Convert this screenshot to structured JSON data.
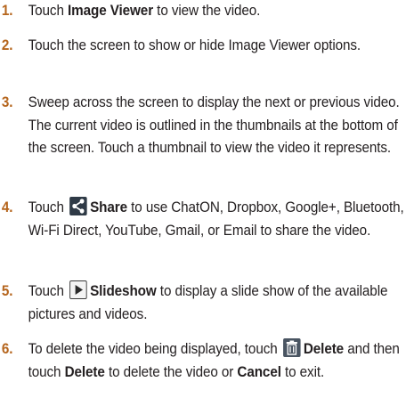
{
  "steps": [
    {
      "num": "1.",
      "parts": [
        {
          "t": "text",
          "v": "Touch "
        },
        {
          "t": "bold",
          "v": "Image Viewer"
        },
        {
          "t": "text",
          "v": " to view the video."
        }
      ]
    },
    {
      "num": "2.",
      "parts": [
        {
          "t": "text",
          "v": "Touch the screen to show or hide Image Viewer options."
        }
      ]
    },
    {
      "num": "3.",
      "parts": [
        {
          "t": "text",
          "v": "Sweep across the screen to display the next or previous video. The current video is outlined in the thumbnails at the bottom of the screen. Touch a thumbnail to view the video it represents."
        }
      ]
    },
    {
      "num": "4.",
      "parts": [
        {
          "t": "text",
          "v": "Touch "
        },
        {
          "t": "icon",
          "v": "share-icon"
        },
        {
          "t": "bold",
          "v": "Share"
        },
        {
          "t": "text",
          "v": " to use ChatON, Dropbox, Google+, Bluetooth, Wi-Fi Direct, YouTube, Gmail, or Email to share the video."
        }
      ]
    },
    {
      "num": "5.",
      "parts": [
        {
          "t": "text",
          "v": "Touch "
        },
        {
          "t": "icon",
          "v": "slideshow-icon"
        },
        {
          "t": "bold",
          "v": "Slideshow"
        },
        {
          "t": "text",
          "v": " to display a slide show of the available pictures and videos."
        }
      ]
    },
    {
      "num": "6.",
      "parts": [
        {
          "t": "text",
          "v": "To delete the video being displayed, touch "
        },
        {
          "t": "icon",
          "v": "trash-icon"
        },
        {
          "t": "bold",
          "v": "Delete"
        },
        {
          "t": "text",
          "v": " and then touch "
        },
        {
          "t": "bold",
          "v": "Delete"
        },
        {
          "t": "text",
          "v": " to delete the video or "
        },
        {
          "t": "bold",
          "v": "Cancel"
        },
        {
          "t": "text",
          "v": " to exit."
        }
      ]
    }
  ],
  "colors": {
    "step_number": "#b5651d",
    "text": "#231f20"
  }
}
